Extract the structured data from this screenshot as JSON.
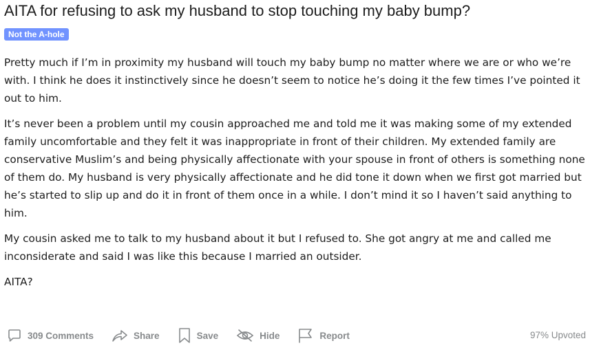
{
  "post": {
    "title": "AITA for refusing to ask my husband to stop touching my baby bump?",
    "flair": "Not the A-hole",
    "flair_color": "#7193ff",
    "paragraphs": [
      "Pretty much if I’m in proximity my husband will touch my baby bump no matter where we are or who we’re with. I think he does it instinctively since he doesn’t seem to notice he’s doing it the few times I’ve pointed it out to him.",
      "It’s never been a problem until my cousin approached me and told me it was making some of my extended family uncomfortable and they felt it was inappropriate in front of their children. My extended family are conservative Muslim’s and being physically affectionate with your spouse in front of others is something none of them do. My husband is very physically affectionate and he did tone it down when we first got married but he’s started to slip up and do it in front of them once in a while. I don’t mind it so I haven’t said anything to him.",
      "My cousin asked me to talk to my husband about it but I refused to. She got angry at me and called me inconsiderate and said I was like this because I married an outsider.",
      "AITA?"
    ]
  },
  "actions": {
    "comments": {
      "label": "309 Comments",
      "icon": "comment-icon"
    },
    "share": {
      "label": "Share",
      "icon": "share-icon"
    },
    "save": {
      "label": "Save",
      "icon": "bookmark-icon"
    },
    "hide": {
      "label": "Hide",
      "icon": "eye-slash-icon"
    },
    "report": {
      "label": "Report",
      "icon": "flag-icon"
    },
    "upvoted": "97% Upvoted"
  },
  "colors": {
    "text": "#1c1c1c",
    "muted": "#878a8c"
  }
}
